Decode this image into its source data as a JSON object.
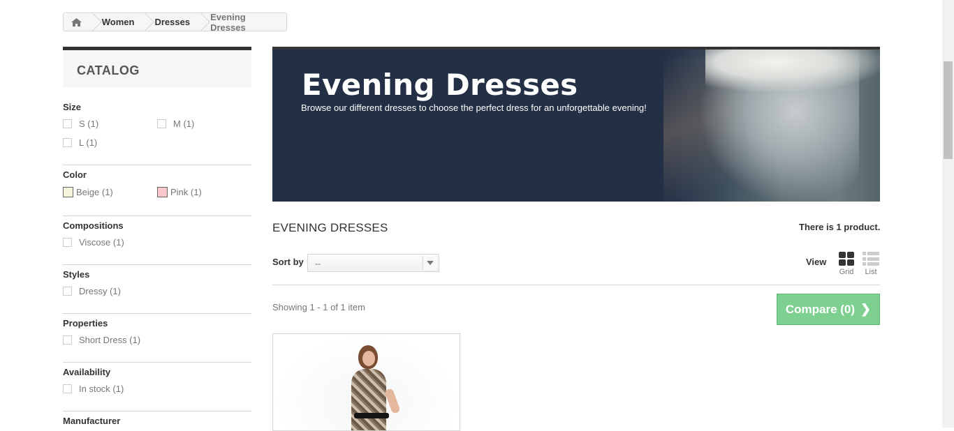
{
  "breadcrumb": {
    "home_icon": "home-icon",
    "items": [
      "Women",
      "Dresses"
    ],
    "current": "Evening Dresses"
  },
  "sidebar": {
    "heading": "CATALOG",
    "filters": {
      "size": {
        "title": "Size",
        "options": [
          "S (1)",
          "M (1)",
          "L (1)"
        ]
      },
      "color": {
        "title": "Color",
        "options": [
          {
            "label": "Beige (1)",
            "color": "#f5f5dc"
          },
          {
            "label": "Pink (1)",
            "color": "#fcc7cc"
          }
        ]
      },
      "compositions": {
        "title": "Compositions",
        "options": [
          "Viscose (1)"
        ]
      },
      "styles": {
        "title": "Styles",
        "options": [
          "Dressy (1)"
        ]
      },
      "properties": {
        "title": "Properties",
        "options": [
          "Short Dress (1)"
        ]
      },
      "availability": {
        "title": "Availability",
        "options": [
          "In stock (1)"
        ]
      },
      "manufacturer": {
        "title": "Manufacturer"
      }
    }
  },
  "banner": {
    "title": "Evening Dresses",
    "description": "Browse our different dresses to choose the perfect dress for an unforgettable evening!"
  },
  "category": {
    "name": "EVENING DRESSES",
    "count_text": "There is 1 product."
  },
  "toolbar": {
    "sort_label": "Sort by",
    "sort_value": "--",
    "view_label": "View",
    "grid_label": "Grid",
    "list_label": "List",
    "showing": "Showing 1 - 1 of 1 item",
    "compare_label": "Compare (0)"
  },
  "colors": {
    "compare_green": "#7ed091",
    "banner_bg": "#232f45"
  }
}
